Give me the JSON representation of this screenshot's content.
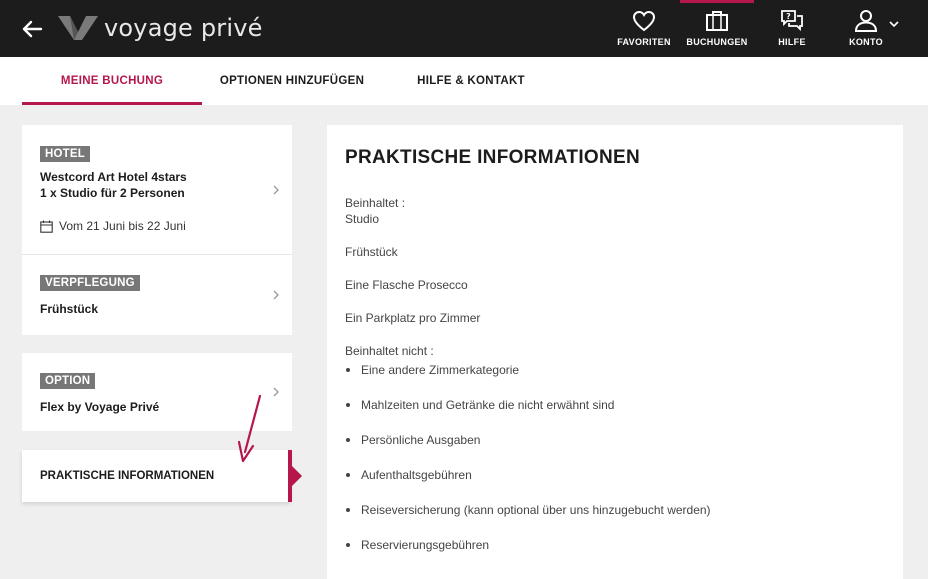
{
  "header": {
    "brand": "voyage privé",
    "nav": [
      {
        "label": "FAVORITEN",
        "icon": "heart-icon"
      },
      {
        "label": "BUCHUNGEN",
        "icon": "suitcase-icon"
      },
      {
        "label": "HILFE",
        "icon": "help-chat-icon"
      },
      {
        "label": "KONTO",
        "icon": "user-icon"
      }
    ]
  },
  "tabs": [
    {
      "label": "MEINE BUCHUNG",
      "active": true
    },
    {
      "label": "OPTIONEN HINZUFÜGEN",
      "active": false
    },
    {
      "label": "HILFE & KONTAKT",
      "active": false
    }
  ],
  "sidebar": {
    "hotel": {
      "badge": "HOTEL",
      "name": "Westcord Art Hotel 4stars",
      "room": "1 x Studio für 2 Personen",
      "dates": "Vom 21 Juni bis 22 Juni"
    },
    "board": {
      "badge": "VERPFLEGUNG",
      "value": "Frühstück"
    },
    "option": {
      "badge": "OPTION",
      "value": "Flex by Voyage Privé"
    },
    "active_item": "PRAKTISCHE INFORMATIONEN"
  },
  "main": {
    "title": "PRAKTISCHE INFORMATIONEN",
    "included_label": "Beinhaltet :",
    "included": [
      "Studio",
      "Frühstück",
      "Eine Flasche Prosecco",
      "Ein Parkplatz pro Zimmer"
    ],
    "not_included_label": "Beinhaltet nicht :",
    "not_included": [
      "Eine andere Zimmerkategorie",
      "Mahlzeiten und Getränke die nicht erwähnt sind",
      "Persönliche Ausgaben",
      "Aufenthaltsgebühren",
      "Reiseversicherung (kann optional über uns hinzugebucht werden)",
      "Reservierungsgebühren"
    ]
  },
  "colors": {
    "accent": "#b5174b",
    "topbar": "#1c1c1c",
    "badge": "#777777"
  }
}
